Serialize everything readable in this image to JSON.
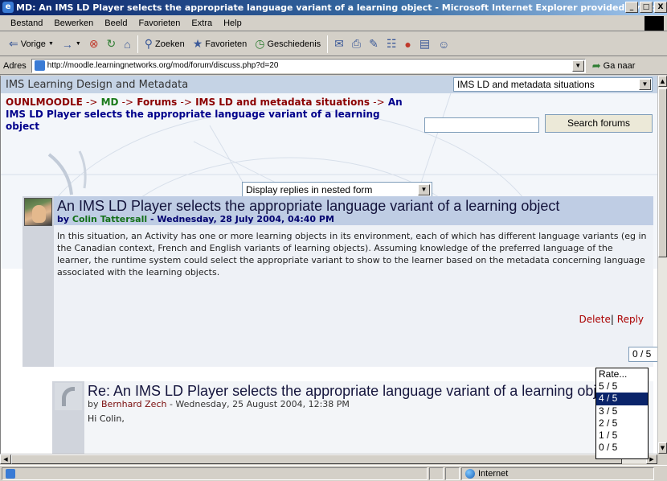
{
  "window": {
    "title": "MD: An IMS LD Player selects the appropriate language variant of a learning object - Microsoft Internet Explorer provided by Op",
    "min_label": "_",
    "max_label": "□",
    "close_label": "X"
  },
  "menu": [
    "Bestand",
    "Bewerken",
    "Beeld",
    "Favorieten",
    "Extra",
    "Help"
  ],
  "toolbar": {
    "back": "Vorige",
    "forward_icon": "→",
    "stop_icon": "⊗",
    "refresh_icon": "↻",
    "home_icon": "⌂",
    "search": "Zoeken",
    "favorites": "Favorieten",
    "history": "Geschiedenis",
    "mail_icon": "✉",
    "print_icon": "⎙",
    "edit_icon": "✎",
    "discuss_icon": "☷",
    "messenger_icon": "●",
    "research_icon": "▤",
    "user_icon": "☺"
  },
  "address": {
    "label": "Adres",
    "url": "http://moodle.learningnetworks.org/mod/forum/discuss.php?d=20",
    "go": "Ga naar"
  },
  "page": {
    "site_title": "IMS Learning Design and Metadata",
    "jump_menu_value": "IMS LD and metadata situations",
    "breadcrumb": {
      "c1": "OUNLMOODLE",
      "sep": "->",
      "c2": "MD",
      "c3": "Forums",
      "c4": "IMS LD and metadata situations",
      "current": "An IMS LD Player selects the appropriate language variant of a learning object"
    },
    "search_button": "Search forums",
    "display_mode": "Display replies in nested form"
  },
  "posts": [
    {
      "subject": "An IMS LD Player selects the appropriate language variant of a learning object",
      "by": "by",
      "author": "Colin Tattersall",
      "date": "- Wednesday, 28 July 2004, 04:40 PM",
      "body": "In this situation, an Activity has one or more learning objects in its environment, each of which has different language variants (eg in the Canadian context, French and English variants of learning objects). Assuming knowledge of the preferred language of the learner, the runtime system could select the appropriate variant to show to the learner based on the metadata concerning language associated with the learning objects.",
      "delete": "Delete",
      "reply": "Reply",
      "rating": "0 / 5"
    },
    {
      "subject": "Re: An IMS LD Player selects the appropriate language variant of a learning object",
      "by": "by",
      "author": "Bernhard Zech",
      "date": "- Wednesday, 25 August 2004, 12:38 PM",
      "body": "Hi Colin,"
    }
  ],
  "rating_options": [
    "Rate...",
    "5 / 5",
    "4 / 5",
    "3 / 5",
    "2 / 5",
    "1 / 5",
    "0 / 5"
  ],
  "rating_highlighted": "4 / 5",
  "status": {
    "zone": "Internet"
  }
}
